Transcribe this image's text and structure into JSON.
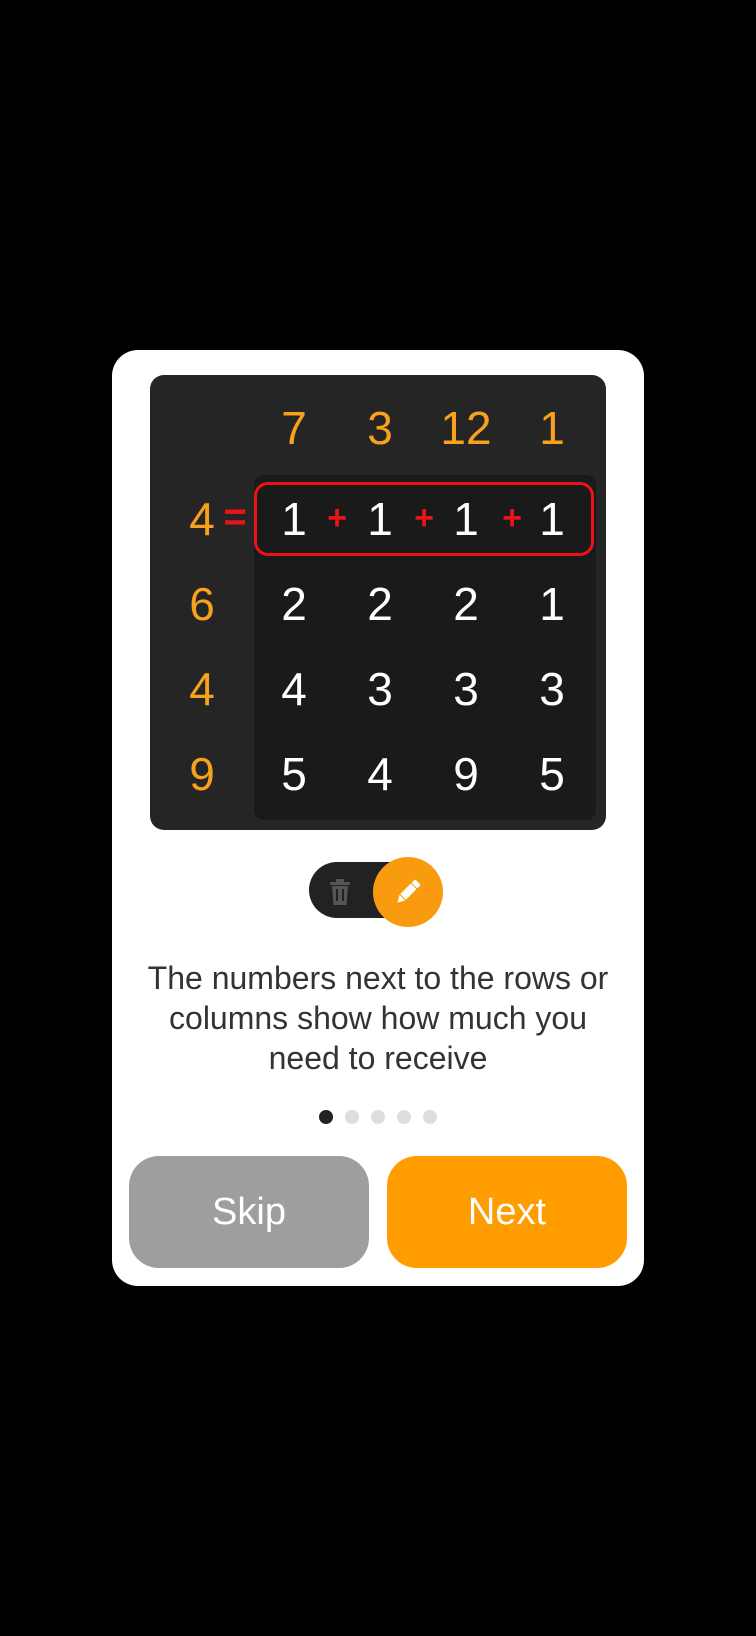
{
  "puzzle": {
    "column_clues": [
      "7",
      "3",
      "12",
      "1"
    ],
    "row_clues": [
      "4",
      "6",
      "4",
      "9"
    ],
    "equals_sign": "=",
    "plus_sign": "+",
    "rows": [
      [
        "1",
        "1",
        "1",
        "1"
      ],
      [
        "2",
        "2",
        "2",
        "1"
      ],
      [
        "4",
        "3",
        "3",
        "3"
      ],
      [
        "5",
        "4",
        "9",
        "5"
      ]
    ]
  },
  "mode_toggle": {
    "left_icon": "trash-icon",
    "right_icon": "pencil-icon",
    "selected": "pencil"
  },
  "tutorial": {
    "description": "The numbers next to the rows or columns show how much you need to receive",
    "page_count": 5,
    "current_page": 1
  },
  "buttons": {
    "skip_label": "Skip",
    "next_label": "Next"
  },
  "colors": {
    "accent": "#ff9c00",
    "clue": "#f7a11c",
    "highlight": "#e8141a"
  }
}
